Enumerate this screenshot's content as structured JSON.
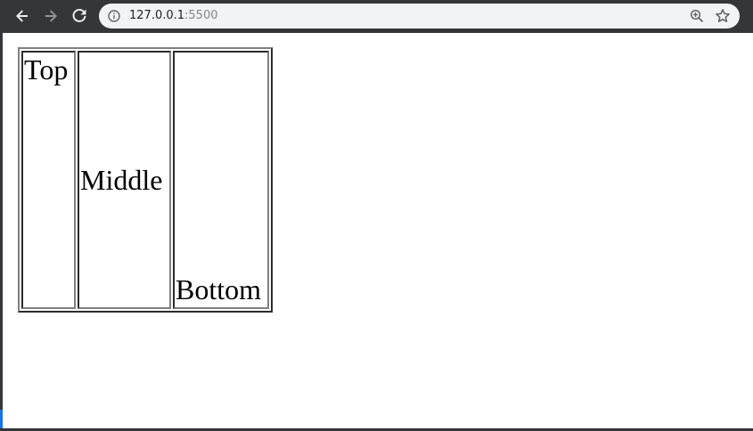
{
  "browser": {
    "url_host": "127.0.0.1",
    "url_port": ":5500",
    "icons": {
      "back": "arrow-left-icon",
      "forward": "arrow-right-icon",
      "reload": "reload-icon",
      "info": "info-icon",
      "zoom": "zoom-in-icon",
      "bookmark": "star-icon"
    },
    "colors": {
      "chrome": "#35363a",
      "omnibox": "#f1f3f4",
      "accent": "#1a73e8"
    }
  },
  "page": {
    "table": {
      "cells": [
        "Top",
        "Middle",
        "Bottom"
      ]
    }
  }
}
